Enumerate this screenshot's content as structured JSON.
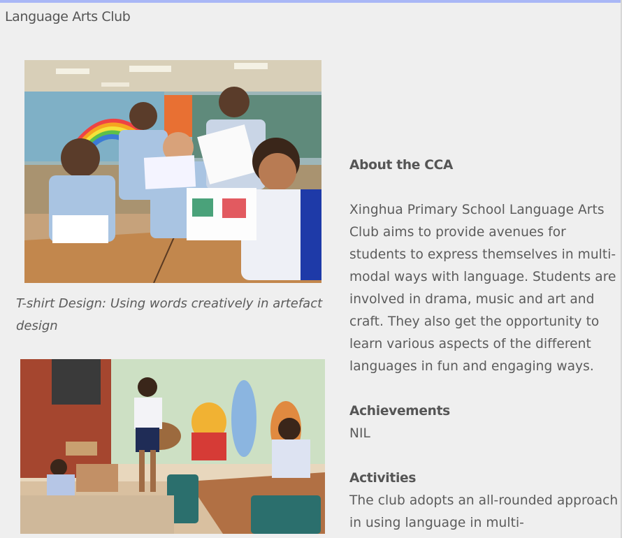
{
  "page": {
    "title": "Language Arts Club"
  },
  "images": {
    "photo1": {
      "caption": " T-shirt Design: Using words creatively in artefact design"
    }
  },
  "about": {
    "heading": "About the CCA",
    "body": "Xinghua Primary School Language Arts Club aims to provide avenues for students to express themselves in multi-modal ways with language. Students are involved in drama, music and art and craft. They also get the opportunity to learn various aspects of the different languages in fun and engaging ways."
  },
  "achievements": {
    "heading": "Achievements",
    "body": "NIL"
  },
  "activities": {
    "heading": "Activities",
    "body": "The club adopts an all-rounded approach in using language in multi-"
  },
  "colors": {
    "top_border": "#a9b7f6",
    "background": "#efefef",
    "text": "#555555"
  }
}
